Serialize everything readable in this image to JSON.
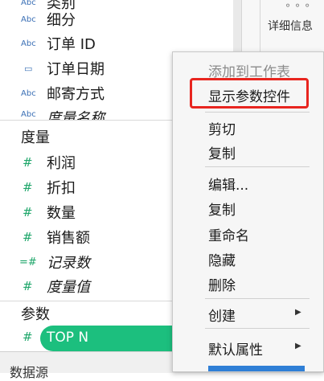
{
  "dimensions": {
    "section_label": "",
    "fields": [
      {
        "icon": "Abc",
        "label": "细分"
      },
      {
        "icon": "Abc",
        "label": "订单 ID"
      },
      {
        "icon": "calendar-icon",
        "label": "订单日期"
      },
      {
        "icon": "Abc",
        "label": "邮寄方式"
      },
      {
        "icon": "Abc",
        "label": "度量名称"
      }
    ]
  },
  "measures": {
    "section_label": "度量",
    "fields": [
      {
        "icon": "#",
        "label": "利润"
      },
      {
        "icon": "#",
        "label": "折扣"
      },
      {
        "icon": "#",
        "label": "数量"
      },
      {
        "icon": "#",
        "label": "销售额"
      },
      {
        "icon": "=#",
        "label": "记录数"
      },
      {
        "icon": "#",
        "label": "度量值"
      }
    ]
  },
  "parameters": {
    "section_label": "参数",
    "items": [
      {
        "icon": "#",
        "label": "TOP N"
      }
    ]
  },
  "bottom_bar": {
    "tab_label": "数据源"
  },
  "right_panel": {
    "detail_label": "详细信息",
    "detail_icon": "dots-icon"
  },
  "context_menu": {
    "items": [
      {
        "label": "添加到工作表",
        "disabled": true
      },
      {
        "label": "显示参数控件",
        "highlighted": true
      },
      {
        "label": "剪切"
      },
      {
        "label": "复制"
      },
      {
        "label": "编辑..."
      },
      {
        "label": "复制"
      },
      {
        "label": "重命名"
      },
      {
        "label": "隐藏"
      },
      {
        "label": "删除"
      },
      {
        "label": "创建",
        "has_submenu": true
      },
      {
        "label": "默认属性",
        "has_submenu": true
      }
    ],
    "highlight_color": "#e8251f"
  },
  "colors": {
    "pill": "#1cbf7e",
    "measure_icon": "#1ea66a",
    "dimension_icon": "#3a6fb5"
  }
}
